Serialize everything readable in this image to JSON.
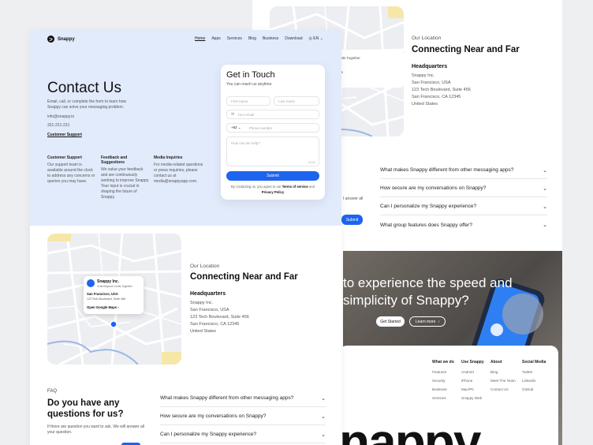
{
  "back": {
    "location": {
      "label": "Our Location",
      "title": "Connecting Near and Far",
      "hq_title": "Headquarters",
      "lines": [
        "Snappy Inc.",
        "San Francisco, USA",
        "123 Tech Boulevard, Suite 456",
        "San Francisco, CA 12345",
        "United States"
      ]
    },
    "map_fragments": {
      "line1": "mits Together",
      "line2": "ite"
    },
    "faq": [
      "What makes Snappy different from other messaging apps?",
      "How secure are my conversations on Snappy?",
      "Can I personalize my Snappy experience?",
      "What group features does Snappy offer?"
    ],
    "partial_text": "I answer all",
    "partial_submit": "Submit",
    "cta": {
      "line1": "to experience the speed and",
      "line2": "simplicity of Snappy?",
      "primary": "Get Started",
      "secondary": "Learn more",
      "arrow": "›"
    },
    "footer": {
      "columns": [
        {
          "title": "What we do",
          "items": [
            "Features",
            "Security",
            "Business",
            "Services"
          ]
        },
        {
          "title": "Use Snappy",
          "items": [
            "Android",
            "iPhone",
            "Mac/PC",
            "Snappy Web"
          ]
        },
        {
          "title": "About",
          "items": [
            "Blog",
            "Meet The Team",
            "Contact Us"
          ]
        },
        {
          "title": "Social Media",
          "items": [
            "Twitter",
            "LinkedIn",
            "GitHub"
          ]
        }
      ],
      "big_word": "nappy"
    }
  },
  "front": {
    "brand": "Snappy",
    "nav": [
      "Home",
      "Apps",
      "Services",
      "Blog",
      "Business",
      "Download"
    ],
    "lang": "EN",
    "title": "Contact Us",
    "intro": "Email, call, or complete the form to learn how Snappy can solve your messaging problem.",
    "email": "info@snappy.io",
    "phone": "321-221-231",
    "support_link": "Customer Support",
    "columns": [
      {
        "title": "Customer Support",
        "text": "Our support team is available around the clock to address any concerns or queries you may have."
      },
      {
        "title": "Feedback and Suggestions",
        "text": "We value your feedback and are continuously working to improve Snappy. Your input is crucial in shaping the future of Snappy."
      },
      {
        "title": "Media Inquiries",
        "text": "For media-related questions or press inquiries, please contact us at media@snappyapp.com."
      }
    ],
    "form": {
      "title": "Get in Touch",
      "subtitle": "You can reach us anytime",
      "first_name": "First name",
      "last_name": "Last name",
      "email": "Your email",
      "code": "+62",
      "phone": "Phone number",
      "message": "How can we help?",
      "counter": "0/120",
      "submit": "Submit",
      "terms_pre": "By contacting us, you agree to our",
      "terms": "Terms of service",
      "and": "and",
      "privacy": "Privacy Policy"
    },
    "map_card": {
      "name": "Snappy Inc.",
      "tagline": "Chat Beyond Limits Together",
      "city": "San Francisco, USA",
      "address": "123 Tech Boulevard, Suite 456",
      "link": "Open Google Maps"
    },
    "location": {
      "label": "Our Location",
      "title": "Connecting Near and Far",
      "hq_title": "Headquarters",
      "lines": [
        "Snappy Inc.",
        "San Francisco, USA",
        "123 Tech Boulevard, Suite 456",
        "San Francisco, CA 12345",
        "United States"
      ]
    },
    "faq": {
      "label": "FAQ",
      "title": "Do you have any questions for us?",
      "text": "If there are question you want to ask. We will answer all your question.",
      "items": [
        "What makes Snappy different from other messaging apps?",
        "How secure are my conversations on Snappy?",
        "Can I personalize my Snappy experience?"
      ]
    }
  },
  "colors": {
    "accent": "#1d64ef",
    "hero_bg": "#e2ebfc",
    "page_bg": "#eeeff1"
  }
}
